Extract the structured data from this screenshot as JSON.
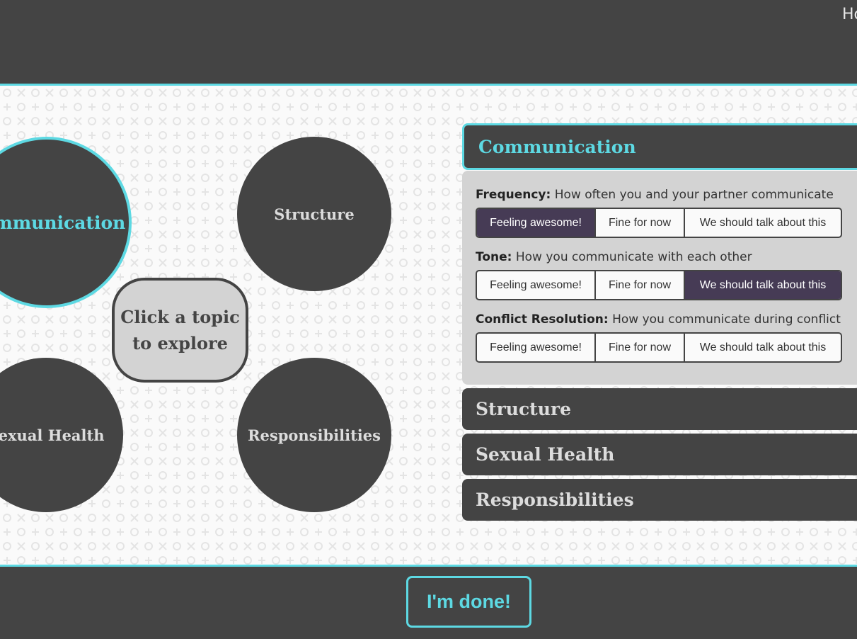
{
  "header": {
    "link_partial": "Ho"
  },
  "bubbles": {
    "communication": "Communication",
    "structure": "Structure",
    "sexual_health": "Sexual Health",
    "responsibilities": "Responsibilities"
  },
  "center_prompt": {
    "line1": "Click a topic",
    "line2": "to explore"
  },
  "panels": {
    "communication": "Communication",
    "structure": "Structure",
    "sexual_health": "Sexual Health",
    "responsibilities": "Responsibilities"
  },
  "questions": [
    {
      "label": "Frequency:",
      "text": "How often you and your partner communicate",
      "selected": "Feeling awesome!"
    },
    {
      "label": "Tone:",
      "text": "How you communicate with each other",
      "selected": "We should talk about this"
    },
    {
      "label": "Conflict Resolution:",
      "text": "How you communicate during conflict",
      "selected": ""
    }
  ],
  "options": [
    "Feeling awesome!",
    "Fine for now",
    "We should talk about this"
  ],
  "footer": {
    "done_label": "I'm done!"
  },
  "colors": {
    "accent": "#5dd9e3",
    "dark": "#444444",
    "selected": "#463b55",
    "panel": "#d3d3d3"
  }
}
